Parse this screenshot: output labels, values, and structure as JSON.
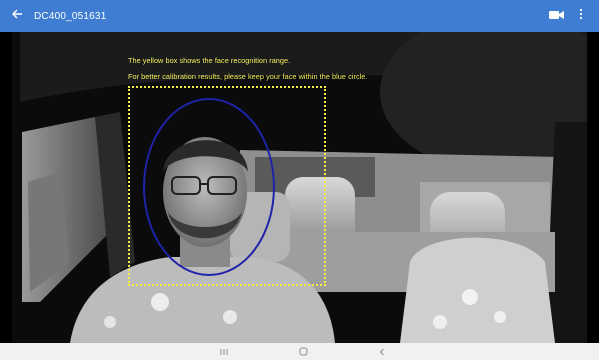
{
  "appbar": {
    "title": "DC400_051631",
    "background": "#3f7dd3",
    "icons": {
      "back": "arrow-left-icon",
      "video": "video-camera-icon",
      "more": "more-vert-icon"
    }
  },
  "camera": {
    "hint_line_1": "The yellow box shows the face recognition range.",
    "hint_line_2": "For better calibration results, please keep your face within the blue circle.",
    "hint_color": "#f3ef5a",
    "box_color": "#f4ee3c",
    "circle_color": "#1f23a8"
  },
  "navbar": {
    "icons": {
      "recents": "recents-icon",
      "home": "home-icon",
      "back": "back-chevron-icon"
    }
  }
}
